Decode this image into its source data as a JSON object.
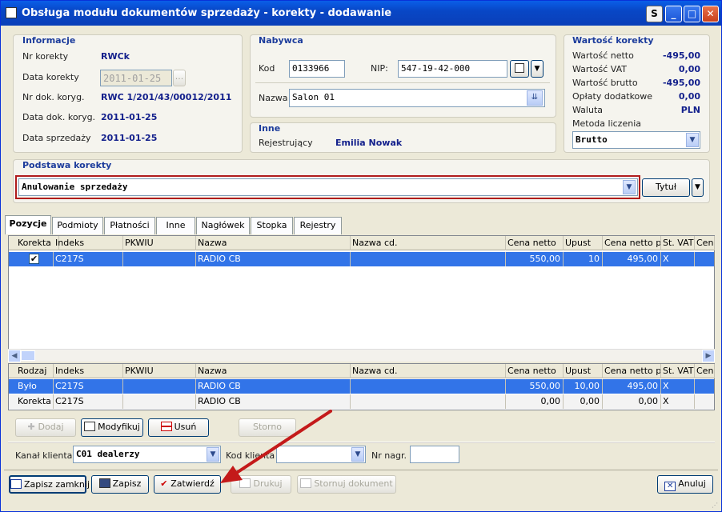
{
  "window": {
    "title": "Obsługa modułu dokumentów sprzedaży - korekty - dodawanie",
    "s_btn": "S",
    "min": "_",
    "max": "□",
    "close": "✕"
  },
  "informacje": {
    "title": "Informacje",
    "nr_korekty_label": "Nr korekty",
    "nr_korekty": "RWCk",
    "data_korekty_label": "Data korekty",
    "data_korekty": "2011-01-25",
    "data_btn": "...",
    "nr_dok_label": "Nr dok. koryg.",
    "nr_dok": "RWC 1/201/43/00012/2011",
    "data_dok_label": "Data dok. koryg.",
    "data_dok": "2011-01-25",
    "data_sprz_label": "Data sprzedaży",
    "data_sprz": "2011-01-25"
  },
  "nabywca": {
    "title": "Nabywca",
    "kod_label": "Kod",
    "kod": "0133966",
    "nip_label": "NIP:",
    "nip": "547-19-42-000",
    "nazwa_label": "Nazwa",
    "nazwa": "Salon 01"
  },
  "inne": {
    "title": "Inne",
    "rej_label": "Rejestrujący",
    "rej": "Emilia Nowak"
  },
  "wartosc": {
    "title": "Wartość korekty",
    "rows": [
      {
        "label": "Wartość netto",
        "value": "-495,00"
      },
      {
        "label": "Wartość VAT",
        "value": "0,00"
      },
      {
        "label": "Wartość brutto",
        "value": "-495,00"
      },
      {
        "label": "Opłaty dodatkowe",
        "value": "0,00"
      },
      {
        "label": "Waluta",
        "value": "PLN"
      }
    ],
    "metoda_label": "Metoda liczenia",
    "metoda": "Brutto"
  },
  "podstawa": {
    "title": "Podstawa korekty",
    "value": "Anulowanie sprzedaży",
    "tytul_btn": "Tytuł"
  },
  "tabs": [
    "Pozycje",
    "Podmioty",
    "Płatności",
    "Inne",
    "Nagłówek",
    "Stopka",
    "Rejestry"
  ],
  "grid1": {
    "headers": [
      "Korekta",
      "Indeks",
      "PKWIU",
      "Nazwa",
      "Nazwa cd.",
      "Cena netto",
      "Upust",
      "Cena netto p...",
      "St. VAT",
      "Cena"
    ],
    "rows": [
      {
        "korekta": "✔",
        "indeks": "C217S",
        "pkwiu": "",
        "nazwa": "RADIO CB",
        "nazwa_cd": "",
        "cena": "550,00",
        "upust": "10",
        "cena_po": "495,00",
        "vat": "X"
      }
    ]
  },
  "grid2": {
    "headers": [
      "Rodzaj",
      "Indeks",
      "PKWIU",
      "Nazwa",
      "Nazwa cd.",
      "Cena netto",
      "Upust",
      "Cena netto p...",
      "St. VAT",
      "Cena"
    ],
    "rows": [
      {
        "rodzaj": "Było",
        "indeks": "C217S",
        "pkwiu": "",
        "nazwa": "RADIO CB",
        "nazwa_cd": "",
        "cena": "550,00",
        "upust": "10,00",
        "cena_po": "495,00",
        "vat": "X"
      },
      {
        "rodzaj": "Korekta",
        "indeks": "C217S",
        "pkwiu": "",
        "nazwa": "RADIO CB",
        "nazwa_cd": "",
        "cena": "0,00",
        "upust": "0,00",
        "cena_po": "0,00",
        "vat": "X"
      }
    ]
  },
  "actions": {
    "dodaj": "Dodaj",
    "modyfikuj": "Modyfikuj",
    "usun": "Usuń",
    "storno": "Storno"
  },
  "kanal": {
    "label": "Kanał klienta",
    "code": "C01",
    "value": "dealerzy",
    "kod_label": "Kod klienta",
    "nr_label": "Nr nagr."
  },
  "bottom": {
    "zapisz_zamknij": "Zapisz zamknij",
    "zapisz": "Zapisz",
    "zatwierdz": "Zatwierdź",
    "drukuj": "Drukuj",
    "stornuj": "Stornuj dokument",
    "anuluj": "Anuluj"
  }
}
